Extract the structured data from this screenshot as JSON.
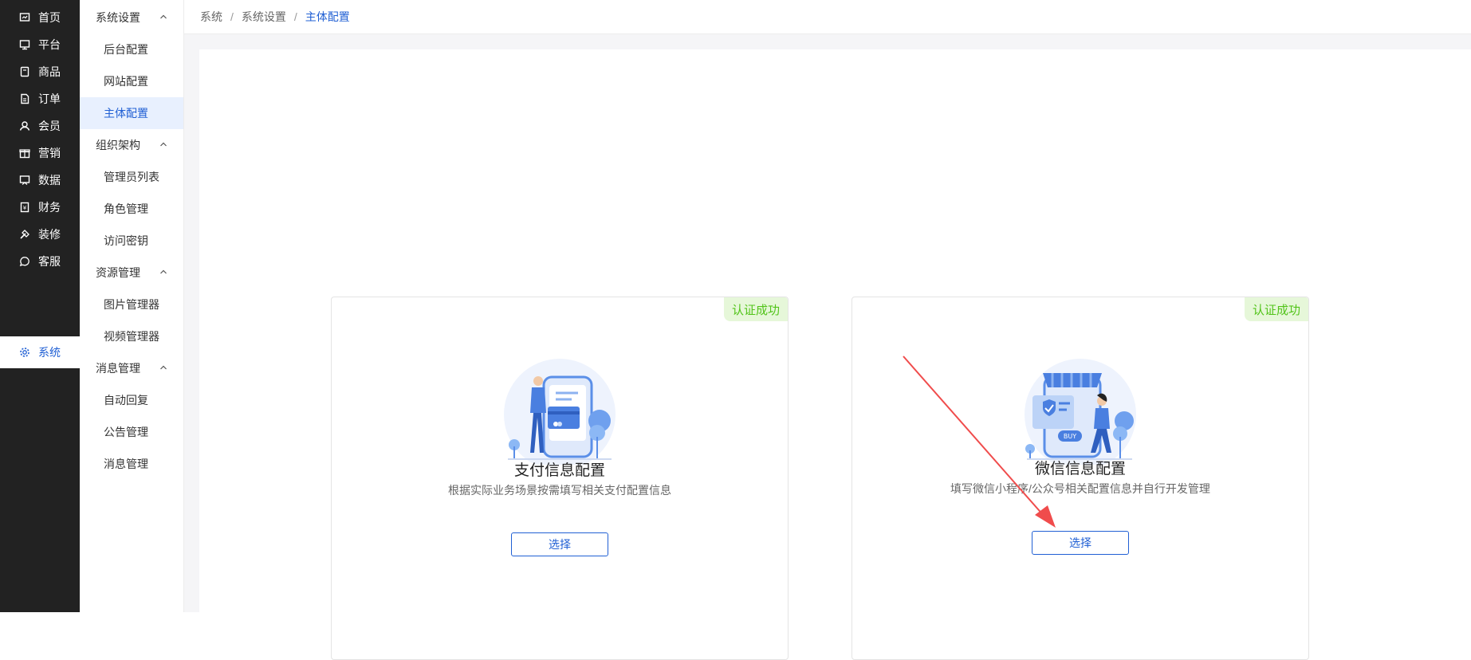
{
  "nav": {
    "items": [
      {
        "label": "首页",
        "icon": "home-icon"
      },
      {
        "label": "平台",
        "icon": "monitor-icon"
      },
      {
        "label": "商品",
        "icon": "product-icon"
      },
      {
        "label": "订单",
        "icon": "order-icon"
      },
      {
        "label": "会员",
        "icon": "member-icon"
      },
      {
        "label": "营销",
        "icon": "gift-icon"
      },
      {
        "label": "数据",
        "icon": "chart-icon"
      },
      {
        "label": "财务",
        "icon": "finance-icon"
      },
      {
        "label": "装修",
        "icon": "decorate-icon"
      },
      {
        "label": "客服",
        "icon": "chat-icon"
      },
      {
        "label": "系统",
        "icon": "gear-icon"
      }
    ],
    "active_index": 10
  },
  "submenu": {
    "groups": [
      {
        "label": "系统设置",
        "items": [
          "后台配置",
          "网站配置",
          "主体配置"
        ]
      },
      {
        "label": "组织架构",
        "items": [
          "管理员列表",
          "角色管理",
          "访问密钥"
        ]
      },
      {
        "label": "资源管理",
        "items": [
          "图片管理器",
          "视频管理器"
        ]
      },
      {
        "label": "消息管理",
        "items": [
          "自动回复",
          "公告管理",
          "消息管理"
        ]
      }
    ],
    "active_item": "主体配置"
  },
  "breadcrumb": {
    "items": [
      "系统",
      "系统设置",
      "主体配置"
    ],
    "separator": "/"
  },
  "cards": [
    {
      "badge": "认证成功",
      "title": "支付信息配置",
      "desc": "根据实际业务场景按需填写相关支付配置信息",
      "button": "选择",
      "illustration": "payment-illustration-icon"
    },
    {
      "badge": "认证成功",
      "title": "微信信息配置",
      "desc": "填写微信小程序/公众号相关配置信息并自行开发管理",
      "button": "选择",
      "illustration": "wechat-shop-illustration-icon"
    }
  ],
  "colors": {
    "nav_bg": "#222222",
    "accent": "#2160d4",
    "badge_bg": "#e6f7d9",
    "badge_text": "#52c41a",
    "arrow": "#f04c4c"
  }
}
